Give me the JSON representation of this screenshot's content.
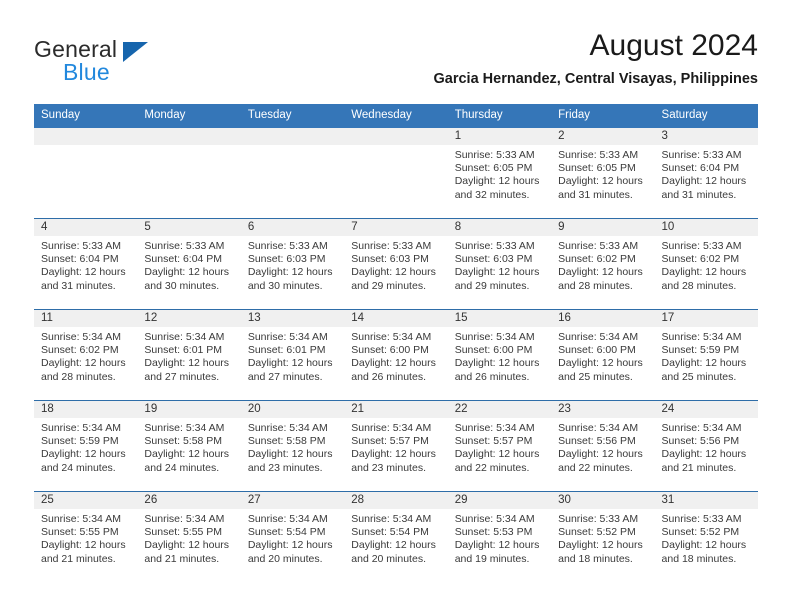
{
  "brand": {
    "name_top": "General",
    "name_bottom": "Blue",
    "accent_color": "#2288dd",
    "triangle_color": "#1665ad"
  },
  "header": {
    "title": "August 2024",
    "subtitle": "Garcia Hernandez, Central Visayas, Philippines",
    "header_bg_color": "#3576b8",
    "daynum_bg_color": "#f0f0f0",
    "row_divider_color": "#2e6da8"
  },
  "weekday_headers": [
    "Sunday",
    "Monday",
    "Tuesday",
    "Wednesday",
    "Thursday",
    "Friday",
    "Saturday"
  ],
  "labels": {
    "sunrise_prefix": "Sunrise:",
    "sunset_prefix": "Sunset:",
    "daylight_prefix": "Daylight:"
  },
  "weeks": [
    [
      {
        "day": "",
        "empty": true
      },
      {
        "day": "",
        "empty": true
      },
      {
        "day": "",
        "empty": true
      },
      {
        "day": "",
        "empty": true
      },
      {
        "day": "1",
        "sunrise": "Sunrise: 5:33 AM",
        "sunset": "Sunset: 6:05 PM",
        "daylight": "Daylight: 12 hours and 32 minutes."
      },
      {
        "day": "2",
        "sunrise": "Sunrise: 5:33 AM",
        "sunset": "Sunset: 6:05 PM",
        "daylight": "Daylight: 12 hours and 31 minutes."
      },
      {
        "day": "3",
        "sunrise": "Sunrise: 5:33 AM",
        "sunset": "Sunset: 6:04 PM",
        "daylight": "Daylight: 12 hours and 31 minutes."
      }
    ],
    [
      {
        "day": "4",
        "sunrise": "Sunrise: 5:33 AM",
        "sunset": "Sunset: 6:04 PM",
        "daylight": "Daylight: 12 hours and 31 minutes."
      },
      {
        "day": "5",
        "sunrise": "Sunrise: 5:33 AM",
        "sunset": "Sunset: 6:04 PM",
        "daylight": "Daylight: 12 hours and 30 minutes."
      },
      {
        "day": "6",
        "sunrise": "Sunrise: 5:33 AM",
        "sunset": "Sunset: 6:03 PM",
        "daylight": "Daylight: 12 hours and 30 minutes."
      },
      {
        "day": "7",
        "sunrise": "Sunrise: 5:33 AM",
        "sunset": "Sunset: 6:03 PM",
        "daylight": "Daylight: 12 hours and 29 minutes."
      },
      {
        "day": "8",
        "sunrise": "Sunrise: 5:33 AM",
        "sunset": "Sunset: 6:03 PM",
        "daylight": "Daylight: 12 hours and 29 minutes."
      },
      {
        "day": "9",
        "sunrise": "Sunrise: 5:33 AM",
        "sunset": "Sunset: 6:02 PM",
        "daylight": "Daylight: 12 hours and 28 minutes."
      },
      {
        "day": "10",
        "sunrise": "Sunrise: 5:33 AM",
        "sunset": "Sunset: 6:02 PM",
        "daylight": "Daylight: 12 hours and 28 minutes."
      }
    ],
    [
      {
        "day": "11",
        "sunrise": "Sunrise: 5:34 AM",
        "sunset": "Sunset: 6:02 PM",
        "daylight": "Daylight: 12 hours and 28 minutes."
      },
      {
        "day": "12",
        "sunrise": "Sunrise: 5:34 AM",
        "sunset": "Sunset: 6:01 PM",
        "daylight": "Daylight: 12 hours and 27 minutes."
      },
      {
        "day": "13",
        "sunrise": "Sunrise: 5:34 AM",
        "sunset": "Sunset: 6:01 PM",
        "daylight": "Daylight: 12 hours and 27 minutes."
      },
      {
        "day": "14",
        "sunrise": "Sunrise: 5:34 AM",
        "sunset": "Sunset: 6:00 PM",
        "daylight": "Daylight: 12 hours and 26 minutes."
      },
      {
        "day": "15",
        "sunrise": "Sunrise: 5:34 AM",
        "sunset": "Sunset: 6:00 PM",
        "daylight": "Daylight: 12 hours and 26 minutes."
      },
      {
        "day": "16",
        "sunrise": "Sunrise: 5:34 AM",
        "sunset": "Sunset: 6:00 PM",
        "daylight": "Daylight: 12 hours and 25 minutes."
      },
      {
        "day": "17",
        "sunrise": "Sunrise: 5:34 AM",
        "sunset": "Sunset: 5:59 PM",
        "daylight": "Daylight: 12 hours and 25 minutes."
      }
    ],
    [
      {
        "day": "18",
        "sunrise": "Sunrise: 5:34 AM",
        "sunset": "Sunset: 5:59 PM",
        "daylight": "Daylight: 12 hours and 24 minutes."
      },
      {
        "day": "19",
        "sunrise": "Sunrise: 5:34 AM",
        "sunset": "Sunset: 5:58 PM",
        "daylight": "Daylight: 12 hours and 24 minutes."
      },
      {
        "day": "20",
        "sunrise": "Sunrise: 5:34 AM",
        "sunset": "Sunset: 5:58 PM",
        "daylight": "Daylight: 12 hours and 23 minutes."
      },
      {
        "day": "21",
        "sunrise": "Sunrise: 5:34 AM",
        "sunset": "Sunset: 5:57 PM",
        "daylight": "Daylight: 12 hours and 23 minutes."
      },
      {
        "day": "22",
        "sunrise": "Sunrise: 5:34 AM",
        "sunset": "Sunset: 5:57 PM",
        "daylight": "Daylight: 12 hours and 22 minutes."
      },
      {
        "day": "23",
        "sunrise": "Sunrise: 5:34 AM",
        "sunset": "Sunset: 5:56 PM",
        "daylight": "Daylight: 12 hours and 22 minutes."
      },
      {
        "day": "24",
        "sunrise": "Sunrise: 5:34 AM",
        "sunset": "Sunset: 5:56 PM",
        "daylight": "Daylight: 12 hours and 21 minutes."
      }
    ],
    [
      {
        "day": "25",
        "sunrise": "Sunrise: 5:34 AM",
        "sunset": "Sunset: 5:55 PM",
        "daylight": "Daylight: 12 hours and 21 minutes."
      },
      {
        "day": "26",
        "sunrise": "Sunrise: 5:34 AM",
        "sunset": "Sunset: 5:55 PM",
        "daylight": "Daylight: 12 hours and 21 minutes."
      },
      {
        "day": "27",
        "sunrise": "Sunrise: 5:34 AM",
        "sunset": "Sunset: 5:54 PM",
        "daylight": "Daylight: 12 hours and 20 minutes."
      },
      {
        "day": "28",
        "sunrise": "Sunrise: 5:34 AM",
        "sunset": "Sunset: 5:54 PM",
        "daylight": "Daylight: 12 hours and 20 minutes."
      },
      {
        "day": "29",
        "sunrise": "Sunrise: 5:34 AM",
        "sunset": "Sunset: 5:53 PM",
        "daylight": "Daylight: 12 hours and 19 minutes."
      },
      {
        "day": "30",
        "sunrise": "Sunrise: 5:33 AM",
        "sunset": "Sunset: 5:52 PM",
        "daylight": "Daylight: 12 hours and 18 minutes."
      },
      {
        "day": "31",
        "sunrise": "Sunrise: 5:33 AM",
        "sunset": "Sunset: 5:52 PM",
        "daylight": "Daylight: 12 hours and 18 minutes."
      }
    ]
  ]
}
